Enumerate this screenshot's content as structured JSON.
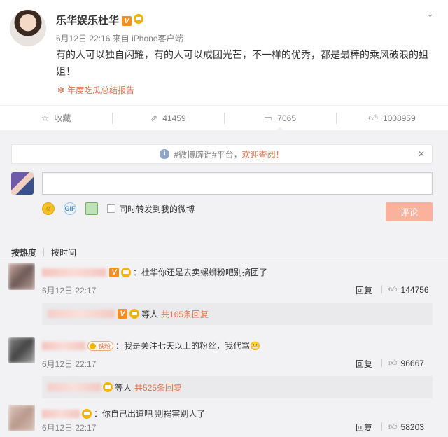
{
  "post": {
    "author": "乐华娱乐杜华",
    "time": "6月12日 22:16",
    "source_prefix": "来自",
    "source": "iPhone客户端",
    "text": "有的人可以独自闪耀，有的人可以成团光芒，不一样的优秀，都是最棒的乘风破浪的姐姐！",
    "report": "年度吃瓜总结报告",
    "more_icon": "chevron-down-icon"
  },
  "actions": [
    {
      "label": "收藏",
      "icon": "star-icon"
    },
    {
      "label": "41459",
      "icon": "repost-icon"
    },
    {
      "label": "7065",
      "icon": "comment-icon"
    },
    {
      "label": "1008959",
      "icon": "like-icon"
    }
  ],
  "notice": {
    "tag": "#微博辟谣#平台，",
    "link": "欢迎查阅！",
    "close": "✕"
  },
  "composer": {
    "placeholder": "",
    "repost_label": "同时转发到我的微博",
    "submit_label": "评论"
  },
  "sort": {
    "hot": "按热度",
    "time": "按时间"
  },
  "comments": [
    {
      "text": "：杜华你还是去卖螺蛳粉吧别搞团了",
      "time": "6月12日 22:17",
      "reply": "回复",
      "likes": "144756",
      "sub_suffix": "等人",
      "sub_total": "共165条回复"
    },
    {
      "badge": "铁粉",
      "text": "：我是关注七天以上的粉丝，我代骂😬",
      "time": "6月12日 22:17",
      "reply": "回复",
      "likes": "96667",
      "sub_suffix": "等人",
      "sub_total": "共525条回复"
    },
    {
      "text": "：你自己出道吧 别祸害别人了",
      "time": "6月12日 22:17",
      "reply": "回复",
      "likes": "58203"
    }
  ],
  "colors": {
    "accent": "#eb7350",
    "submit_disabled": "#fbb29c",
    "bg_gray": "#f2f2f5"
  }
}
